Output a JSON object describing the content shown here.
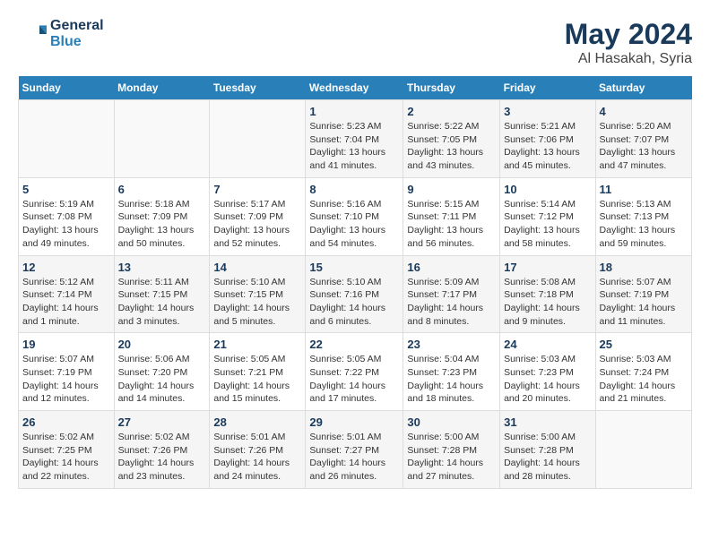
{
  "header": {
    "logo_line1": "General",
    "logo_line2": "Blue",
    "main_title": "May 2024",
    "subtitle": "Al Hasakah, Syria"
  },
  "days_of_week": [
    "Sunday",
    "Monday",
    "Tuesday",
    "Wednesday",
    "Thursday",
    "Friday",
    "Saturday"
  ],
  "weeks": [
    [
      {
        "num": "",
        "info": ""
      },
      {
        "num": "",
        "info": ""
      },
      {
        "num": "",
        "info": ""
      },
      {
        "num": "1",
        "info": "Sunrise: 5:23 AM\nSunset: 7:04 PM\nDaylight: 13 hours\nand 41 minutes."
      },
      {
        "num": "2",
        "info": "Sunrise: 5:22 AM\nSunset: 7:05 PM\nDaylight: 13 hours\nand 43 minutes."
      },
      {
        "num": "3",
        "info": "Sunrise: 5:21 AM\nSunset: 7:06 PM\nDaylight: 13 hours\nand 45 minutes."
      },
      {
        "num": "4",
        "info": "Sunrise: 5:20 AM\nSunset: 7:07 PM\nDaylight: 13 hours\nand 47 minutes."
      }
    ],
    [
      {
        "num": "5",
        "info": "Sunrise: 5:19 AM\nSunset: 7:08 PM\nDaylight: 13 hours\nand 49 minutes."
      },
      {
        "num": "6",
        "info": "Sunrise: 5:18 AM\nSunset: 7:09 PM\nDaylight: 13 hours\nand 50 minutes."
      },
      {
        "num": "7",
        "info": "Sunrise: 5:17 AM\nSunset: 7:09 PM\nDaylight: 13 hours\nand 52 minutes."
      },
      {
        "num": "8",
        "info": "Sunrise: 5:16 AM\nSunset: 7:10 PM\nDaylight: 13 hours\nand 54 minutes."
      },
      {
        "num": "9",
        "info": "Sunrise: 5:15 AM\nSunset: 7:11 PM\nDaylight: 13 hours\nand 56 minutes."
      },
      {
        "num": "10",
        "info": "Sunrise: 5:14 AM\nSunset: 7:12 PM\nDaylight: 13 hours\nand 58 minutes."
      },
      {
        "num": "11",
        "info": "Sunrise: 5:13 AM\nSunset: 7:13 PM\nDaylight: 13 hours\nand 59 minutes."
      }
    ],
    [
      {
        "num": "12",
        "info": "Sunrise: 5:12 AM\nSunset: 7:14 PM\nDaylight: 14 hours\nand 1 minute."
      },
      {
        "num": "13",
        "info": "Sunrise: 5:11 AM\nSunset: 7:15 PM\nDaylight: 14 hours\nand 3 minutes."
      },
      {
        "num": "14",
        "info": "Sunrise: 5:10 AM\nSunset: 7:15 PM\nDaylight: 14 hours\nand 5 minutes."
      },
      {
        "num": "15",
        "info": "Sunrise: 5:10 AM\nSunset: 7:16 PM\nDaylight: 14 hours\nand 6 minutes."
      },
      {
        "num": "16",
        "info": "Sunrise: 5:09 AM\nSunset: 7:17 PM\nDaylight: 14 hours\nand 8 minutes."
      },
      {
        "num": "17",
        "info": "Sunrise: 5:08 AM\nSunset: 7:18 PM\nDaylight: 14 hours\nand 9 minutes."
      },
      {
        "num": "18",
        "info": "Sunrise: 5:07 AM\nSunset: 7:19 PM\nDaylight: 14 hours\nand 11 minutes."
      }
    ],
    [
      {
        "num": "19",
        "info": "Sunrise: 5:07 AM\nSunset: 7:19 PM\nDaylight: 14 hours\nand 12 minutes."
      },
      {
        "num": "20",
        "info": "Sunrise: 5:06 AM\nSunset: 7:20 PM\nDaylight: 14 hours\nand 14 minutes."
      },
      {
        "num": "21",
        "info": "Sunrise: 5:05 AM\nSunset: 7:21 PM\nDaylight: 14 hours\nand 15 minutes."
      },
      {
        "num": "22",
        "info": "Sunrise: 5:05 AM\nSunset: 7:22 PM\nDaylight: 14 hours\nand 17 minutes."
      },
      {
        "num": "23",
        "info": "Sunrise: 5:04 AM\nSunset: 7:23 PM\nDaylight: 14 hours\nand 18 minutes."
      },
      {
        "num": "24",
        "info": "Sunrise: 5:03 AM\nSunset: 7:23 PM\nDaylight: 14 hours\nand 20 minutes."
      },
      {
        "num": "25",
        "info": "Sunrise: 5:03 AM\nSunset: 7:24 PM\nDaylight: 14 hours\nand 21 minutes."
      }
    ],
    [
      {
        "num": "26",
        "info": "Sunrise: 5:02 AM\nSunset: 7:25 PM\nDaylight: 14 hours\nand 22 minutes."
      },
      {
        "num": "27",
        "info": "Sunrise: 5:02 AM\nSunset: 7:26 PM\nDaylight: 14 hours\nand 23 minutes."
      },
      {
        "num": "28",
        "info": "Sunrise: 5:01 AM\nSunset: 7:26 PM\nDaylight: 14 hours\nand 24 minutes."
      },
      {
        "num": "29",
        "info": "Sunrise: 5:01 AM\nSunset: 7:27 PM\nDaylight: 14 hours\nand 26 minutes."
      },
      {
        "num": "30",
        "info": "Sunrise: 5:00 AM\nSunset: 7:28 PM\nDaylight: 14 hours\nand 27 minutes."
      },
      {
        "num": "31",
        "info": "Sunrise: 5:00 AM\nSunset: 7:28 PM\nDaylight: 14 hours\nand 28 minutes."
      },
      {
        "num": "",
        "info": ""
      }
    ]
  ]
}
